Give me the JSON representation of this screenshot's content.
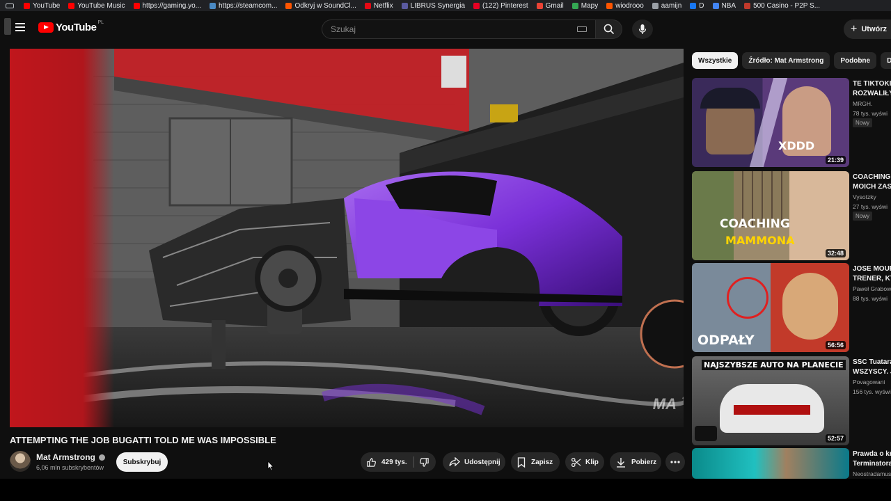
{
  "bookmarks": [
    {
      "label": "YouTube",
      "color": "#ff0000"
    },
    {
      "label": "YouTube Music",
      "color": "#ff0000"
    },
    {
      "label": "https://gaming.yo...",
      "color": "#ff0000"
    },
    {
      "label": "https://steamcom...",
      "color": "#4a8ac4"
    },
    {
      "label": "Odkryj w SoundCl...",
      "color": "#ff5500"
    },
    {
      "label": "Netflix",
      "color": "#e50914"
    },
    {
      "label": "LIBRUS Synergia",
      "color": "#5a5aa0"
    },
    {
      "label": "(122) Pinterest",
      "color": "#e60023"
    },
    {
      "label": "Gmail",
      "color": "#ea4335"
    },
    {
      "label": "Mapy",
      "color": "#34a853"
    },
    {
      "label": "wiodrooo",
      "color": "#ff5500"
    },
    {
      "label": "aamijn",
      "color": "#9aa0a6"
    },
    {
      "label": "D",
      "color": "#1877f2"
    },
    {
      "label": "NBA",
      "color": "#4285f4"
    },
    {
      "label": "500 Casino - P2P S...",
      "color": "#c0392b"
    }
  ],
  "header": {
    "logo_text": "YouTube",
    "country_code": "PL",
    "search_placeholder": "Szukaj",
    "create_label": "Utwórz"
  },
  "video": {
    "watermark": "MA",
    "title": "ATTEMPTING THE JOB BUGATTI TOLD ME WAS IMPOSSIBLE",
    "channel": "Mat Armstrong",
    "subscribers": "6,06 mln subskrybentów",
    "subscribe_label": "Subskrybuj",
    "likes": "429 tys.",
    "share_label": "Udostępnij",
    "save_label": "Zapisz",
    "clip_label": "Klip",
    "download_label": "Pobierz"
  },
  "sidebar": {
    "chips": [
      {
        "label": "Wszystkie",
        "active": true
      },
      {
        "label": "Źródło: Mat Armstrong",
        "active": false
      },
      {
        "label": "Podobne",
        "active": false
      },
      {
        "label": "Dla",
        "active": false
      }
    ],
    "recommendations": [
      {
        "title1": "TE TIKTOKI",
        "title2": "ROZWALIŁY",
        "channel": "MRGH.",
        "meta": "78 tys. wyświ",
        "badge": "Nowy",
        "duration": "21:39",
        "thumb_text": "XDDD"
      },
      {
        "title1": "COACHING",
        "title2": "MOICH ZAS",
        "channel": "Vysotzky",
        "meta": "27 tys. wyświ",
        "badge": "Nowy",
        "duration": "32:48",
        "thumb_text1": "COACHING",
        "thumb_text2": "MAMMONA"
      },
      {
        "title1": "JOSE MOUR",
        "title2": "TRENER, KT",
        "channel": "Paweł Grabow",
        "meta": "88 tys. wyświ",
        "badge": "",
        "duration": "56:56",
        "thumb_text": "ODPAŁY"
      },
      {
        "title1": "SSC Tuatara",
        "title2": "WSZYSCY. J",
        "channel": "Povagowani",
        "meta": "156 tys. wyświ",
        "badge": "",
        "duration": "52:57",
        "thumb_text": "NAJSZYBSZE AUTO NA PLANECIE"
      },
      {
        "title1": "Prawda o kr",
        "title2": "Terminatora",
        "channel": "Neostradamus",
        "meta": "",
        "badge": "",
        "duration": "",
        "thumb_text": ""
      }
    ]
  }
}
